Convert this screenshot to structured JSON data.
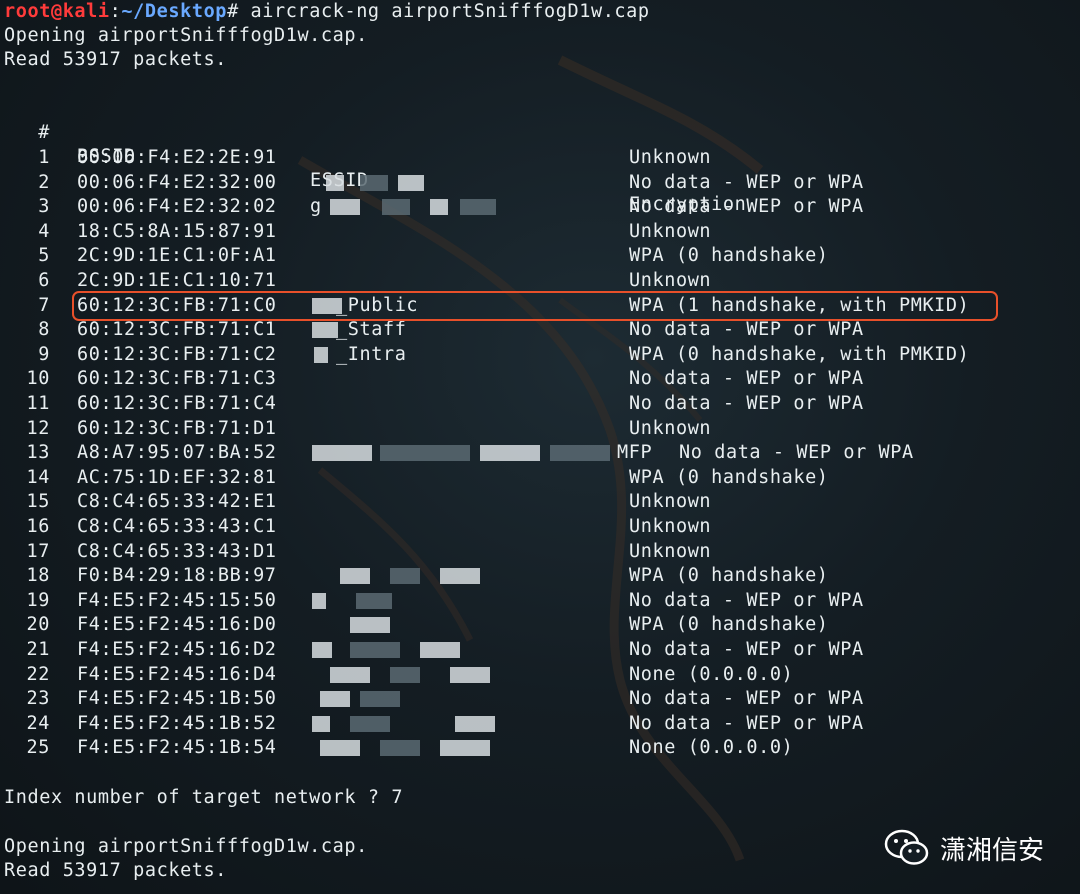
{
  "terminal": {
    "prompt_user": "root@kali",
    "prompt_sep": ":",
    "prompt_path": "~/Desktop",
    "prompt_symbol": "#",
    "command": " aircrack-ng airportSnifffogD1w.cap",
    "opening_line": "Opening airportSnifffogD1w.cap.",
    "read_line": "Read 53917 packets.",
    "headers": {
      "index": "#",
      "bssid": "BSSID",
      "essid": "ESSID",
      "encryption": "Encryption"
    },
    "rows": [
      {
        "idx": "1",
        "bssid": "00:06:F4:E2:2E:91",
        "essid": "",
        "enc": "Unknown"
      },
      {
        "idx": "2",
        "bssid": "00:06:F4:E2:32:00",
        "essid": "",
        "enc": "No data - WEP or WPA"
      },
      {
        "idx": "3",
        "bssid": "00:06:F4:E2:32:02",
        "essid": "g",
        "enc": "No data - WEP or WPA"
      },
      {
        "idx": "4",
        "bssid": "18:C5:8A:15:87:91",
        "essid": "",
        "enc": "Unknown"
      },
      {
        "idx": "5",
        "bssid": "2C:9D:1E:C1:0F:A1",
        "essid": "",
        "enc": "WPA (0 handshake)"
      },
      {
        "idx": "6",
        "bssid": "2C:9D:1E:C1:10:71",
        "essid": "",
        "enc": "Unknown"
      },
      {
        "idx": "7",
        "bssid": "60:12:3C:FB:71:C0",
        "essid": "_Public",
        "enc": "WPA (1 handshake, with PMKID)"
      },
      {
        "idx": "8",
        "bssid": "60:12:3C:FB:71:C1",
        "essid": "_Staff",
        "enc": "No data - WEP or WPA"
      },
      {
        "idx": "9",
        "bssid": "60:12:3C:FB:71:C2",
        "essid": "_Intra",
        "enc": "WPA (0 handshake, with PMKID)"
      },
      {
        "idx": "10",
        "bssid": "60:12:3C:FB:71:C3",
        "essid": "",
        "enc": "No data - WEP or WPA"
      },
      {
        "idx": "11",
        "bssid": "60:12:3C:FB:71:C4",
        "essid": "",
        "enc": "No data - WEP or WPA"
      },
      {
        "idx": "12",
        "bssid": "60:12:3C:FB:71:D1",
        "essid": "",
        "enc": "Unknown"
      },
      {
        "idx": "13",
        "bssid": "A8:A7:95:07:BA:52",
        "essid": "MFP",
        "enc": "No data - WEP or WPA"
      },
      {
        "idx": "14",
        "bssid": "AC:75:1D:EF:32:81",
        "essid": "",
        "enc": "WPA (0 handshake)"
      },
      {
        "idx": "15",
        "bssid": "C8:C4:65:33:42:E1",
        "essid": "",
        "enc": "Unknown"
      },
      {
        "idx": "16",
        "bssid": "C8:C4:65:33:43:C1",
        "essid": "",
        "enc": "Unknown"
      },
      {
        "idx": "17",
        "bssid": "C8:C4:65:33:43:D1",
        "essid": "",
        "enc": "Unknown"
      },
      {
        "idx": "18",
        "bssid": "F0:B4:29:18:BB:97",
        "essid": "",
        "enc": "WPA (0 handshake)"
      },
      {
        "idx": "19",
        "bssid": "F4:E5:F2:45:15:50",
        "essid": "",
        "enc": "No data - WEP or WPA"
      },
      {
        "idx": "20",
        "bssid": "F4:E5:F2:45:16:D0",
        "essid": "",
        "enc": "WPA (0 handshake)"
      },
      {
        "idx": "21",
        "bssid": "F4:E5:F2:45:16:D2",
        "essid": "",
        "enc": "No data - WEP or WPA"
      },
      {
        "idx": "22",
        "bssid": "F4:E5:F2:45:16:D4",
        "essid": "",
        "enc": "None (0.0.0.0)"
      },
      {
        "idx": "23",
        "bssid": "F4:E5:F2:45:1B:50",
        "essid": "",
        "enc": "No data - WEP or WPA"
      },
      {
        "idx": "24",
        "bssid": "F4:E5:F2:45:1B:52",
        "essid": "",
        "enc": "No data - WEP or WPA"
      },
      {
        "idx": "25",
        "bssid": "F4:E5:F2:45:1B:54",
        "essid": "",
        "enc": "None (0.0.0.0)"
      }
    ],
    "index_prompt": "Index number of target network ? 7",
    "opening_line_2": "Opening airportSnifffogD1w.cap.",
    "read_line_2": "Read 53917 packets."
  },
  "watermark": {
    "text": "潇湘信安",
    "icon": "wechat-icon"
  },
  "colors": {
    "highlight": "#e8502a",
    "prompt_user": "#ff3b3b",
    "prompt_path": "#6aa9ff"
  }
}
